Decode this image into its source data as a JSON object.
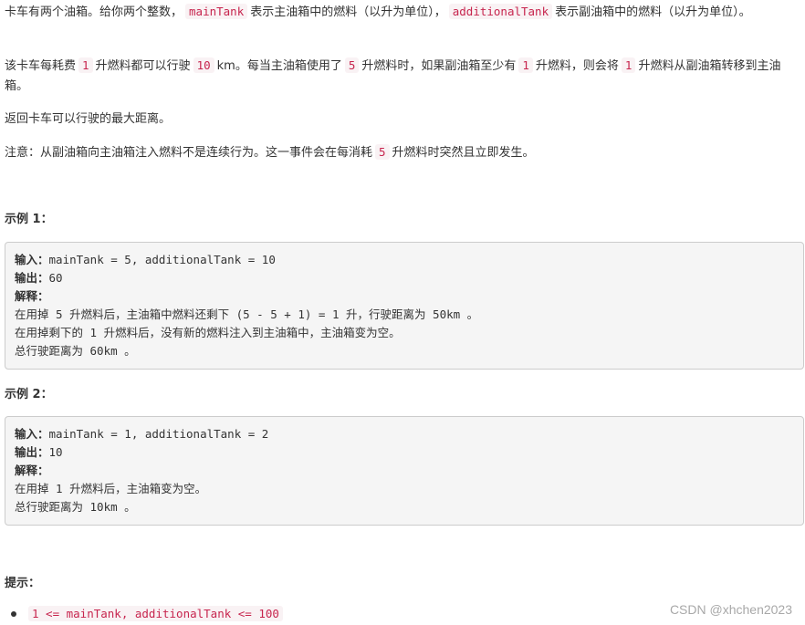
{
  "problem": {
    "p1": {
      "t1": "卡车有两个油箱。给你两个整数，",
      "c1": "mainTank",
      "t2": "表示主油箱中的燃料（以升为单位），",
      "c2": "additionalTank",
      "t3": "表示副油箱中的燃料（以升为单位）。"
    },
    "p2": {
      "t1": "该卡车每耗费",
      "c1": "1",
      "t2": "升燃料都可以行驶",
      "c2": "10",
      "t3": "km。每当主油箱使用了",
      "c3": "5",
      "t4": "升燃料时，如果副油箱至少有",
      "c4": "1",
      "t5": "升燃料，则会将",
      "c5": "1",
      "t6": "升燃料从副油箱转移到主油箱。"
    },
    "p3": "返回卡车可以行驶的最大距离。",
    "p4": {
      "t1": "注意：从副油箱向主油箱注入燃料不是连续行为。这一事件会在每消耗",
      "c1": "5",
      "t2": "升燃料时突然且立即发生。"
    }
  },
  "examples": [
    {
      "title": "示例 1：",
      "input_label": "输入：",
      "input": "mainTank = 5, additionalTank = 10",
      "output_label": "输出：",
      "output": "60",
      "explain_label": "解释：",
      "explain": "在用掉 5 升燃料后，主油箱中燃料还剩下 (5 - 5 + 1) = 1 升，行驶距离为 50km 。\n在用掉剩下的 1 升燃料后，没有新的燃料注入到主油箱中，主油箱变为空。\n总行驶距离为 60km 。"
    },
    {
      "title": "示例 2：",
      "input_label": "输入：",
      "input": "mainTank = 1, additionalTank = 2",
      "output_label": "输出：",
      "output": "10",
      "explain_label": "解释：",
      "explain": "在用掉 1 升燃料后，主油箱变为空。\n总行驶距离为 10km 。"
    }
  ],
  "hints": {
    "title": "提示：",
    "items": [
      "1 <= mainTank, additionalTank <= 100"
    ]
  },
  "watermark": "CSDN @xhchen2023"
}
